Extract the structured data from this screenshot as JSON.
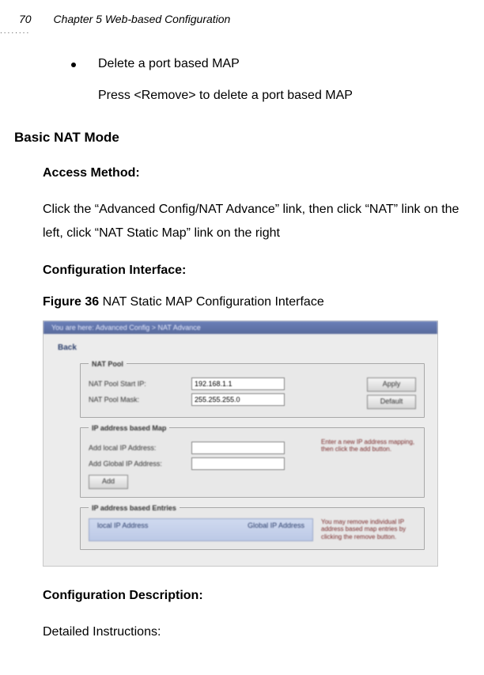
{
  "header": {
    "page_number": "70",
    "chapter": "Chapter 5 Web-based Configuration"
  },
  "bullet": {
    "text": "Delete a port based MAP"
  },
  "bullet_sub": "Press <Remove> to delete a port based MAP",
  "h2": "Basic NAT Mode",
  "access_method_h": "Access Method:",
  "access_method_p": "Click the “Advanced Config/NAT Advance” link, then click “NAT” link on the left, click “NAT Static Map” link on the right",
  "config_iface_h": "Configuration Interface:",
  "figure_label": "Figure 36",
  "figure_caption": " NAT Static MAP Configuration Interface",
  "shot": {
    "crumb": "You are here: Advanced Config > NAT Advance",
    "back": "Back",
    "natpool": {
      "legend": "NAT Pool",
      "row1_label": "NAT Pool Start IP:",
      "row1_value": "192.168.1.1",
      "row2_label": "NAT Pool Mask:",
      "row2_value": "255.255.255.0",
      "btn_apply": "Apply",
      "btn_default": "Default"
    },
    "ipmap": {
      "legend": "IP address based Map",
      "row1_label": "Add local IP Address:",
      "row2_label": "Add Global IP Address:",
      "btn_add": "Add",
      "hint": "Enter a new IP address mapping, then click the add button."
    },
    "entries": {
      "legend": "IP address based Entries",
      "col1": "local IP Address",
      "col2": "Global IP Address",
      "hint": "You may remove individual IP address based map entries by clicking the remove button."
    }
  },
  "config_desc_h": "Configuration Description:",
  "detailed": "Detailed Instructions:"
}
